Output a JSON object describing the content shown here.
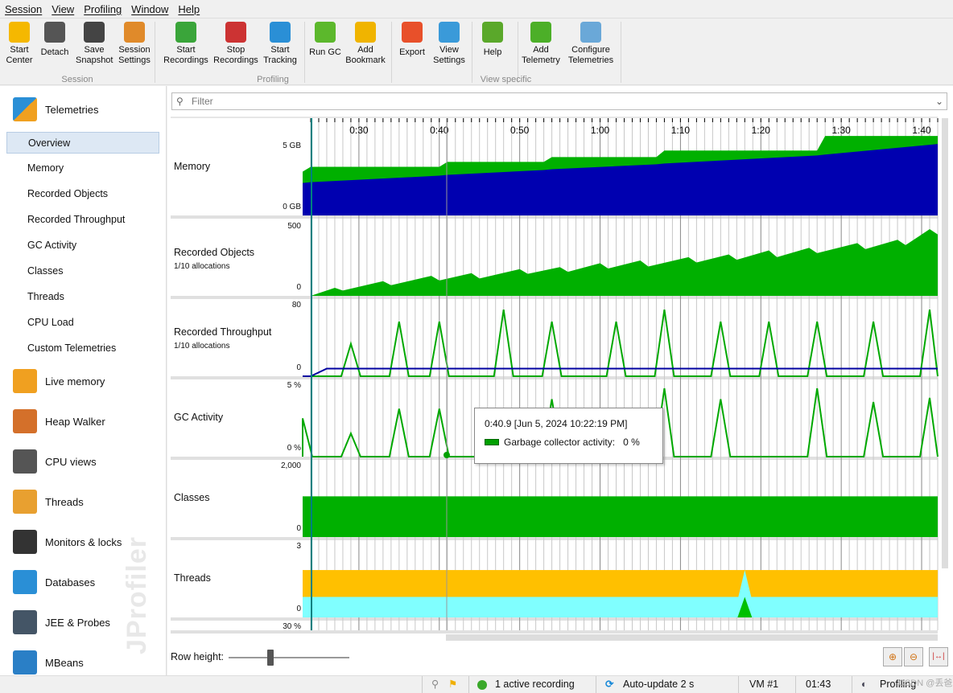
{
  "menu": [
    "Session",
    "View",
    "Profiling",
    "Window",
    "Help"
  ],
  "toolbar": {
    "buttons": [
      {
        "label": "Start\nCenter",
        "icon": "start-center-icon",
        "color": "#f5b800"
      },
      {
        "label": "Detach",
        "icon": "detach-icon",
        "color": "#555555"
      },
      {
        "label": "Save\nSnapshot",
        "icon": "save-icon",
        "color": "#444444"
      },
      {
        "label": "Session\nSettings",
        "icon": "session-settings-icon",
        "color": "#e08a2a"
      },
      {
        "label": "Start\nRecordings",
        "icon": "start-recordings-icon",
        "color": "#3aa53a"
      },
      {
        "label": "Stop\nRecordings",
        "icon": "stop-recordings-icon",
        "color": "#cc3333"
      },
      {
        "label": "Start\nTracking",
        "icon": "start-tracking-icon",
        "color": "#2a8fd6"
      },
      {
        "label": "Run GC",
        "icon": "run-gc-icon",
        "color": "#5cb82c"
      },
      {
        "label": "Add\nBookmark",
        "icon": "add-bookmark-icon",
        "color": "#f0b400"
      },
      {
        "label": "Export",
        "icon": "export-icon",
        "color": "#e8502a"
      },
      {
        "label": "View\nSettings",
        "icon": "view-settings-icon",
        "color": "#3a9ad9"
      },
      {
        "label": "Help",
        "icon": "help-icon",
        "color": "#5aa82a"
      },
      {
        "label": "Add\nTelemetry",
        "icon": "add-icon",
        "color": "#4caf28"
      },
      {
        "label": "Configure\nTelemetries",
        "icon": "configure-telemetries-icon",
        "color": "#6aa8d8"
      }
    ],
    "groups": [
      "Session",
      "Profiling",
      "View specific"
    ]
  },
  "sidebar": {
    "telemetries": "Telemetries",
    "sub_items": [
      "Overview",
      "Memory",
      "Recorded Objects",
      "Recorded Throughput",
      "GC Activity",
      "Classes",
      "Threads",
      "CPU Load",
      "Custom Telemetries"
    ],
    "selected": "Overview",
    "sections": [
      {
        "label": "Live memory",
        "icon": "live-memory-icon",
        "color": "#f0a020"
      },
      {
        "label": "Heap Walker",
        "icon": "heap-walker-icon",
        "color": "#d4702a"
      },
      {
        "label": "CPU views",
        "icon": "cpu-views-icon",
        "color": "#555555"
      },
      {
        "label": "Threads",
        "icon": "threads-icon",
        "color": "#e8a030"
      },
      {
        "label": "Monitors & locks",
        "icon": "lock-icon",
        "color": "#333333"
      },
      {
        "label": "Databases",
        "icon": "database-icon",
        "color": "#2a8fd6"
      },
      {
        "label": "JEE & Probes",
        "icon": "gauge-icon",
        "color": "#445566"
      },
      {
        "label": "MBeans",
        "icon": "globe-icon",
        "color": "#2a7fc6"
      }
    ],
    "watermark": "JProfiler"
  },
  "filter": {
    "placeholder": "Filter"
  },
  "time_axis": {
    "labels": [
      "0:30",
      "0:40",
      "0:50",
      "1:00",
      "1:10",
      "1:20",
      "1:30",
      "1:40"
    ],
    "start_s": 23,
    "end_s": 102
  },
  "rows": [
    {
      "label": "Memory",
      "sub": "",
      "ticks": [
        "5 GB",
        "0 GB"
      ]
    },
    {
      "label": "Recorded Objects",
      "sub": "1/10 allocations",
      "ticks": [
        "500",
        "0"
      ]
    },
    {
      "label": "Recorded Throughput",
      "sub": "1/10 allocations",
      "ticks": [
        "80",
        "0"
      ]
    },
    {
      "label": "GC Activity",
      "sub": "",
      "ticks": [
        "5 %",
        "0 %"
      ]
    },
    {
      "label": "Classes",
      "sub": "",
      "ticks": [
        "2,000",
        "0"
      ]
    },
    {
      "label": "Threads",
      "sub": "",
      "ticks": [
        "3",
        "0"
      ]
    },
    {
      "label": "",
      "sub": "",
      "ticks": [
        "30 %"
      ]
    }
  ],
  "chart_data": [
    {
      "type": "area",
      "name": "Memory",
      "ylim": [
        0,
        5.4
      ],
      "unit": "GB",
      "colors": [
        "#00b000",
        "#0000b0"
      ],
      "x": [
        23,
        24,
        40,
        41,
        53,
        54,
        67,
        68,
        87,
        88,
        102
      ],
      "series": [
        {
          "values": [
            2.7,
            3.0,
            3.0,
            3.3,
            3.3,
            3.6,
            3.6,
            4.0,
            4.0,
            4.9,
            4.9
          ]
        },
        {
          "values": [
            2.0,
            2.05,
            2.45,
            2.5,
            2.8,
            2.85,
            3.15,
            3.2,
            3.7,
            3.75,
            4.4
          ]
        }
      ]
    },
    {
      "type": "area",
      "name": "Recorded Objects",
      "ylim": [
        0,
        500
      ],
      "colors": [
        "#00b000"
      ],
      "x": [
        24,
        27,
        28,
        33,
        34,
        39,
        40,
        44,
        45,
        50,
        51,
        55,
        56,
        60,
        61,
        65,
        66,
        71,
        72,
        76,
        77,
        81,
        82,
        86,
        87,
        92,
        93,
        97,
        98,
        101,
        102
      ],
      "series": [
        {
          "values": [
            0,
            60,
            40,
            110,
            80,
            150,
            115,
            170,
            130,
            200,
            165,
            215,
            180,
            245,
            205,
            265,
            220,
            290,
            250,
            310,
            270,
            340,
            290,
            360,
            320,
            395,
            350,
            420,
            380,
            500,
            460
          ]
        }
      ]
    },
    {
      "type": "line",
      "name": "Recorded Throughput",
      "ylim": [
        0,
        80
      ],
      "colors": [
        "#00a800",
        "#0000a0"
      ],
      "spikes": [
        [
          29,
          38
        ],
        [
          35,
          64
        ],
        [
          40,
          64
        ],
        [
          48,
          78
        ],
        [
          54,
          64
        ],
        [
          62,
          64
        ],
        [
          68,
          78
        ],
        [
          75,
          64
        ],
        [
          81,
          64
        ],
        [
          87,
          64
        ],
        [
          94,
          64
        ],
        [
          101,
          78
        ]
      ],
      "baseline": [
        [
          23,
          0
        ],
        [
          24,
          0
        ],
        [
          26,
          9
        ],
        [
          102,
          9
        ]
      ]
    },
    {
      "type": "line",
      "name": "GC Activity",
      "ylim": [
        0,
        5
      ],
      "colors": [
        "#00a800"
      ],
      "spikes": [
        [
          23,
          2.8
        ],
        [
          29,
          1.7
        ],
        [
          35,
          3.5
        ],
        [
          40,
          3.5
        ],
        [
          54,
          4.2
        ],
        [
          68,
          5
        ],
        [
          75,
          4.2
        ],
        [
          87,
          5
        ],
        [
          94,
          4
        ],
        [
          101,
          4.3
        ]
      ]
    },
    {
      "type": "area",
      "name": "Classes",
      "ylim": [
        0,
        2000
      ],
      "colors": [
        "#00b000"
      ],
      "x": [
        23,
        102
      ],
      "series": [
        {
          "values": [
            1190,
            1190
          ]
        }
      ]
    },
    {
      "type": "area",
      "name": "Threads",
      "ylim": [
        0,
        3
      ],
      "colors": [
        "#ffc000",
        "#80ffff",
        "#00c000"
      ],
      "orange_top": 2.08,
      "cyan_top": 0.9,
      "spike_at": 78
    }
  ],
  "tooltip": {
    "title": "0:40.9 [Jun 5, 2024 10:22:19 PM]",
    "label": "Garbage collector activity:",
    "value": "0 %",
    "color": "#00a000"
  },
  "bottom": {
    "row_height": "Row height:",
    "slider_value": 0.25
  },
  "status": {
    "recording": "1 active recording",
    "autoupdate": "Auto-update 2 s",
    "vm": "VM #1",
    "time": "01:43",
    "mode": "Profiling",
    "watermark": "CSDN @丢爸"
  }
}
